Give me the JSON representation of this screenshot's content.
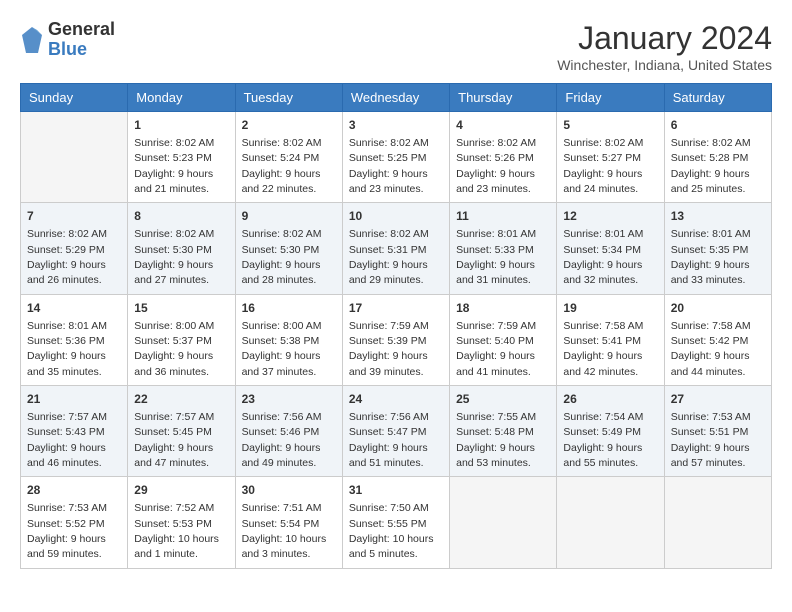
{
  "header": {
    "logo": {
      "line1": "General",
      "line2": "Blue"
    },
    "title": "January 2024",
    "subtitle": "Winchester, Indiana, United States"
  },
  "days_of_week": [
    "Sunday",
    "Monday",
    "Tuesday",
    "Wednesday",
    "Thursday",
    "Friday",
    "Saturday"
  ],
  "weeks": [
    [
      {
        "num": "",
        "sunrise": "",
        "sunset": "",
        "daylight": "",
        "empty": true
      },
      {
        "num": "1",
        "sunrise": "Sunrise: 8:02 AM",
        "sunset": "Sunset: 5:23 PM",
        "daylight": "Daylight: 9 hours and 21 minutes."
      },
      {
        "num": "2",
        "sunrise": "Sunrise: 8:02 AM",
        "sunset": "Sunset: 5:24 PM",
        "daylight": "Daylight: 9 hours and 22 minutes."
      },
      {
        "num": "3",
        "sunrise": "Sunrise: 8:02 AM",
        "sunset": "Sunset: 5:25 PM",
        "daylight": "Daylight: 9 hours and 23 minutes."
      },
      {
        "num": "4",
        "sunrise": "Sunrise: 8:02 AM",
        "sunset": "Sunset: 5:26 PM",
        "daylight": "Daylight: 9 hours and 23 minutes."
      },
      {
        "num": "5",
        "sunrise": "Sunrise: 8:02 AM",
        "sunset": "Sunset: 5:27 PM",
        "daylight": "Daylight: 9 hours and 24 minutes."
      },
      {
        "num": "6",
        "sunrise": "Sunrise: 8:02 AM",
        "sunset": "Sunset: 5:28 PM",
        "daylight": "Daylight: 9 hours and 25 minutes."
      }
    ],
    [
      {
        "num": "7",
        "sunrise": "Sunrise: 8:02 AM",
        "sunset": "Sunset: 5:29 PM",
        "daylight": "Daylight: 9 hours and 26 minutes."
      },
      {
        "num": "8",
        "sunrise": "Sunrise: 8:02 AM",
        "sunset": "Sunset: 5:30 PM",
        "daylight": "Daylight: 9 hours and 27 minutes."
      },
      {
        "num": "9",
        "sunrise": "Sunrise: 8:02 AM",
        "sunset": "Sunset: 5:30 PM",
        "daylight": "Daylight: 9 hours and 28 minutes."
      },
      {
        "num": "10",
        "sunrise": "Sunrise: 8:02 AM",
        "sunset": "Sunset: 5:31 PM",
        "daylight": "Daylight: 9 hours and 29 minutes."
      },
      {
        "num": "11",
        "sunrise": "Sunrise: 8:01 AM",
        "sunset": "Sunset: 5:33 PM",
        "daylight": "Daylight: 9 hours and 31 minutes."
      },
      {
        "num": "12",
        "sunrise": "Sunrise: 8:01 AM",
        "sunset": "Sunset: 5:34 PM",
        "daylight": "Daylight: 9 hours and 32 minutes."
      },
      {
        "num": "13",
        "sunrise": "Sunrise: 8:01 AM",
        "sunset": "Sunset: 5:35 PM",
        "daylight": "Daylight: 9 hours and 33 minutes."
      }
    ],
    [
      {
        "num": "14",
        "sunrise": "Sunrise: 8:01 AM",
        "sunset": "Sunset: 5:36 PM",
        "daylight": "Daylight: 9 hours and 35 minutes."
      },
      {
        "num": "15",
        "sunrise": "Sunrise: 8:00 AM",
        "sunset": "Sunset: 5:37 PM",
        "daylight": "Daylight: 9 hours and 36 minutes."
      },
      {
        "num": "16",
        "sunrise": "Sunrise: 8:00 AM",
        "sunset": "Sunset: 5:38 PM",
        "daylight": "Daylight: 9 hours and 37 minutes."
      },
      {
        "num": "17",
        "sunrise": "Sunrise: 7:59 AM",
        "sunset": "Sunset: 5:39 PM",
        "daylight": "Daylight: 9 hours and 39 minutes."
      },
      {
        "num": "18",
        "sunrise": "Sunrise: 7:59 AM",
        "sunset": "Sunset: 5:40 PM",
        "daylight": "Daylight: 9 hours and 41 minutes."
      },
      {
        "num": "19",
        "sunrise": "Sunrise: 7:58 AM",
        "sunset": "Sunset: 5:41 PM",
        "daylight": "Daylight: 9 hours and 42 minutes."
      },
      {
        "num": "20",
        "sunrise": "Sunrise: 7:58 AM",
        "sunset": "Sunset: 5:42 PM",
        "daylight": "Daylight: 9 hours and 44 minutes."
      }
    ],
    [
      {
        "num": "21",
        "sunrise": "Sunrise: 7:57 AM",
        "sunset": "Sunset: 5:43 PM",
        "daylight": "Daylight: 9 hours and 46 minutes."
      },
      {
        "num": "22",
        "sunrise": "Sunrise: 7:57 AM",
        "sunset": "Sunset: 5:45 PM",
        "daylight": "Daylight: 9 hours and 47 minutes."
      },
      {
        "num": "23",
        "sunrise": "Sunrise: 7:56 AM",
        "sunset": "Sunset: 5:46 PM",
        "daylight": "Daylight: 9 hours and 49 minutes."
      },
      {
        "num": "24",
        "sunrise": "Sunrise: 7:56 AM",
        "sunset": "Sunset: 5:47 PM",
        "daylight": "Daylight: 9 hours and 51 minutes."
      },
      {
        "num": "25",
        "sunrise": "Sunrise: 7:55 AM",
        "sunset": "Sunset: 5:48 PM",
        "daylight": "Daylight: 9 hours and 53 minutes."
      },
      {
        "num": "26",
        "sunrise": "Sunrise: 7:54 AM",
        "sunset": "Sunset: 5:49 PM",
        "daylight": "Daylight: 9 hours and 55 minutes."
      },
      {
        "num": "27",
        "sunrise": "Sunrise: 7:53 AM",
        "sunset": "Sunset: 5:51 PM",
        "daylight": "Daylight: 9 hours and 57 minutes."
      }
    ],
    [
      {
        "num": "28",
        "sunrise": "Sunrise: 7:53 AM",
        "sunset": "Sunset: 5:52 PM",
        "daylight": "Daylight: 9 hours and 59 minutes."
      },
      {
        "num": "29",
        "sunrise": "Sunrise: 7:52 AM",
        "sunset": "Sunset: 5:53 PM",
        "daylight": "Daylight: 10 hours and 1 minute."
      },
      {
        "num": "30",
        "sunrise": "Sunrise: 7:51 AM",
        "sunset": "Sunset: 5:54 PM",
        "daylight": "Daylight: 10 hours and 3 minutes."
      },
      {
        "num": "31",
        "sunrise": "Sunrise: 7:50 AM",
        "sunset": "Sunset: 5:55 PM",
        "daylight": "Daylight: 10 hours and 5 minutes."
      },
      {
        "num": "",
        "sunrise": "",
        "sunset": "",
        "daylight": "",
        "empty": true
      },
      {
        "num": "",
        "sunrise": "",
        "sunset": "",
        "daylight": "",
        "empty": true
      },
      {
        "num": "",
        "sunrise": "",
        "sunset": "",
        "daylight": "",
        "empty": true
      }
    ]
  ]
}
